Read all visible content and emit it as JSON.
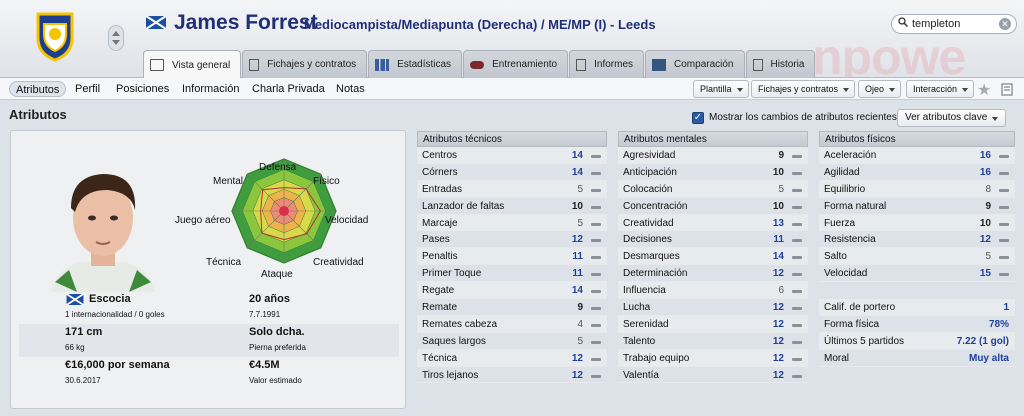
{
  "header": {
    "name": "James Forrest",
    "subtitle": "Mediocampista/Mediapunta (Derecha) / ME/MP (I) - Leeds",
    "search_value": "templeton",
    "watermark": "npowe"
  },
  "tabs": [
    {
      "label": "Vista general"
    },
    {
      "label": "Fichajes y contratos"
    },
    {
      "label": "Estadísticas"
    },
    {
      "label": "Entrenamiento"
    },
    {
      "label": "Informes"
    },
    {
      "label": "Comparación"
    },
    {
      "label": "Historia"
    }
  ],
  "subnav": {
    "items": [
      "Atributos",
      "Perfil",
      "Posiciones",
      "Información",
      "Charla Privada",
      "Notas"
    ],
    "dropdowns": [
      "Plantilla",
      "Fichajes y contratos",
      "Ojeo",
      "Interacción"
    ]
  },
  "section": {
    "title": "Atributos",
    "checkbox_label": "Mostrar los cambios de atributos recientes",
    "key_attr": "Ver atributos clave"
  },
  "radar": {
    "labels": [
      "Defensa",
      "Físico",
      "Velocidad",
      "Creatividad",
      "Ataque",
      "Técnica",
      "Juego aéreo",
      "Mental"
    ],
    "levels": [
      0.45,
      0.6,
      0.7,
      0.62,
      0.55,
      0.6,
      0.45,
      0.58
    ]
  },
  "bio": {
    "nation": "Escocia",
    "intl": "1 internacionalidad / 0 goles",
    "age": "20 años",
    "dob": "7.7.1991",
    "height": "171 cm",
    "weight": "66 kg",
    "foot": "Solo dcha.",
    "foot_label": "Pierna preferida",
    "wage": "€16,000 por semana",
    "contract_end": "30.6.2017",
    "value": "€4.5M",
    "value_label": "Valor estimado"
  },
  "technical": {
    "title": "Atributos técnicos",
    "rows": [
      {
        "name": "Centros",
        "value": "14"
      },
      {
        "name": "Córners",
        "value": "14"
      },
      {
        "name": "Entradas",
        "value": "5"
      },
      {
        "name": "Lanzador de faltas",
        "value": "10"
      },
      {
        "name": "Marcaje",
        "value": "5"
      },
      {
        "name": "Pases",
        "value": "12"
      },
      {
        "name": "Penaltis",
        "value": "11"
      },
      {
        "name": "Primer Toque",
        "value": "11"
      },
      {
        "name": "Regate",
        "value": "14"
      },
      {
        "name": "Remate",
        "value": "9"
      },
      {
        "name": "Remates cabeza",
        "value": "4"
      },
      {
        "name": "Saques largos",
        "value": "5"
      },
      {
        "name": "Técnica",
        "value": "12"
      },
      {
        "name": "Tiros lejanos",
        "value": "12"
      }
    ]
  },
  "mental": {
    "title": "Atributos mentales",
    "rows": [
      {
        "name": "Agresividad",
        "value": "9"
      },
      {
        "name": "Anticipación",
        "value": "10"
      },
      {
        "name": "Colocación",
        "value": "5"
      },
      {
        "name": "Concentración",
        "value": "10"
      },
      {
        "name": "Creatividad",
        "value": "13"
      },
      {
        "name": "Decisiones",
        "value": "11"
      },
      {
        "name": "Desmarques",
        "value": "14"
      },
      {
        "name": "Determinación",
        "value": "12"
      },
      {
        "name": "Influencia",
        "value": "6"
      },
      {
        "name": "Lucha",
        "value": "12"
      },
      {
        "name": "Serenidad",
        "value": "12"
      },
      {
        "name": "Talento",
        "value": "12"
      },
      {
        "name": "Trabajo equipo",
        "value": "12"
      },
      {
        "name": "Valentía",
        "value": "12"
      }
    ]
  },
  "physical": {
    "title": "Atributos físicos",
    "rows": [
      {
        "name": "Aceleración",
        "value": "16"
      },
      {
        "name": "Agilidad",
        "value": "16"
      },
      {
        "name": "Equilibrio",
        "value": "8"
      },
      {
        "name": "Forma natural",
        "value": "9"
      },
      {
        "name": "Fuerza",
        "value": "10"
      },
      {
        "name": "Resistencia",
        "value": "12"
      },
      {
        "name": "Salto",
        "value": "5"
      },
      {
        "name": "Velocidad",
        "value": "15"
      }
    ]
  },
  "extra": [
    {
      "name": "Calif. de portero",
      "value": "1"
    },
    {
      "name": "Forma física",
      "value": "78%"
    },
    {
      "name": "Últimos 5 partidos",
      "value": "7.22 (1 gol)"
    },
    {
      "name": "Moral",
      "value": "Muy alta"
    }
  ],
  "colors": {
    "accent": "#1f2f78",
    "high": "#203f9a"
  }
}
